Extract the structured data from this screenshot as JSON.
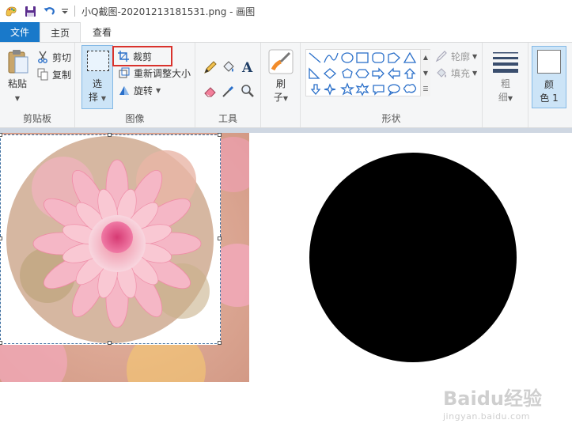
{
  "window": {
    "title": "小Q截图-20201213181531.png - 画图"
  },
  "menu_tabs": {
    "file": "文件",
    "home": "主页",
    "view": "查看"
  },
  "ribbon": {
    "clipboard": {
      "group_label": "剪贴板",
      "paste": "粘贴",
      "cut": "剪切",
      "copy": "复制"
    },
    "image": {
      "group_label": "图像",
      "select_line1": "选",
      "select_line2": "择",
      "crop": "裁剪",
      "resize": "重新调整大小",
      "rotate": "旋转"
    },
    "tools": {
      "group_label": "工具"
    },
    "brushes": {
      "line1": "刷",
      "line2": "子"
    },
    "shapes": {
      "group_label": "形状",
      "outline": "轮廓",
      "fill": "填充"
    },
    "size": {
      "line1": "粗",
      "line2": "细"
    },
    "color1": {
      "line1": "颜",
      "line2": "色 1"
    }
  },
  "colors": {
    "file_tab": "#1979ca",
    "crop_highlight": "#d9322c",
    "selection_border": "#3d6fa0"
  },
  "watermark": {
    "main": "Baidu经验",
    "sub": "jingyan.baidu.com"
  }
}
